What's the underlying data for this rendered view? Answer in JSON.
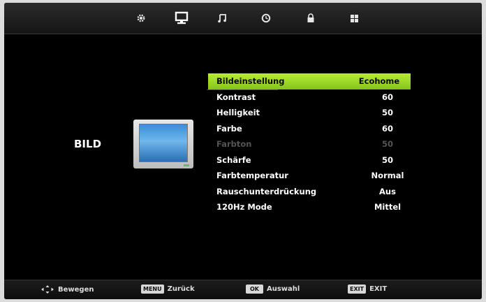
{
  "top_tabs": [
    {
      "name": "settings-tab",
      "icon": "gear-icon"
    },
    {
      "name": "picture-tab",
      "icon": "monitor-icon"
    },
    {
      "name": "sound-tab",
      "icon": "music-note-icon"
    },
    {
      "name": "time-tab",
      "icon": "clock-icon"
    },
    {
      "name": "lock-tab",
      "icon": "lock-icon"
    },
    {
      "name": "apps-tab",
      "icon": "grid-icon"
    }
  ],
  "section": {
    "title": "BILD"
  },
  "menu": {
    "items": [
      {
        "label": "Bildeinstellung",
        "value": "Ecohome",
        "selected": true,
        "disabled": false
      },
      {
        "label": "Kontrast",
        "value": "60",
        "selected": false,
        "disabled": false
      },
      {
        "label": "Helligkeit",
        "value": "50",
        "selected": false,
        "disabled": false
      },
      {
        "label": "Farbe",
        "value": "60",
        "selected": false,
        "disabled": false
      },
      {
        "label": "Farbton",
        "value": "50",
        "selected": false,
        "disabled": true
      },
      {
        "label": "Schärfe",
        "value": "50",
        "selected": false,
        "disabled": false
      },
      {
        "label": "Farbtemperatur",
        "value": "Normal",
        "selected": false,
        "disabled": false
      },
      {
        "label": "Rauschunterdrückung",
        "value": "Aus",
        "selected": false,
        "disabled": false
      },
      {
        "label": "120Hz Mode",
        "value": "Mittel",
        "selected": false,
        "disabled": false
      }
    ]
  },
  "bottom": {
    "move_label": "Bewegen",
    "menu_key": "MENU",
    "back_label": "Zurück",
    "ok_key": "OK",
    "select_label": "Auswahl",
    "exit_key": "EXIT",
    "exit_label": "EXIT"
  },
  "colors": {
    "highlight": "#a6dc2e",
    "background": "#000000",
    "text": "#ffffff",
    "disabled_text": "#555555"
  }
}
